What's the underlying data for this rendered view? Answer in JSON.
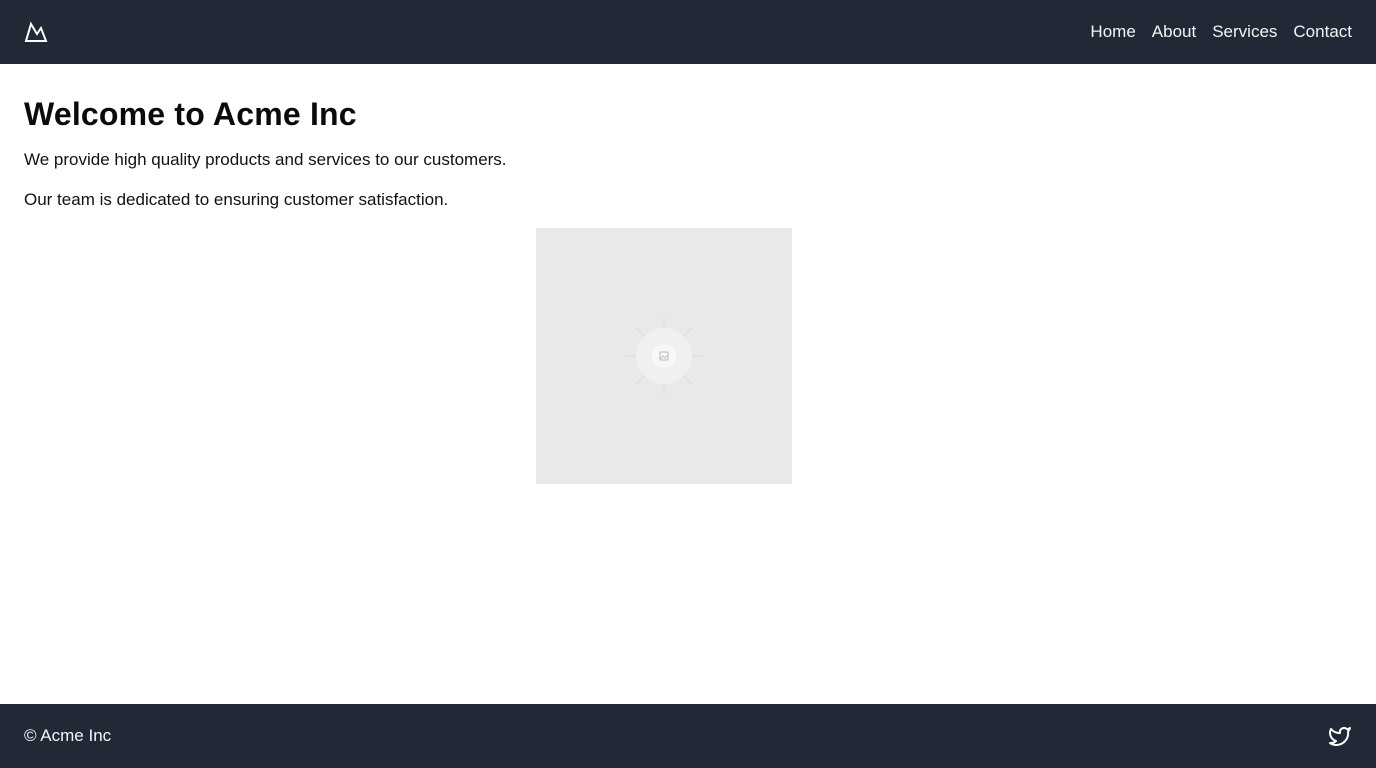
{
  "header": {
    "logo_icon": "mountain-icon",
    "nav": [
      {
        "label": "Home"
      },
      {
        "label": "About"
      },
      {
        "label": "Services"
      },
      {
        "label": "Contact"
      }
    ]
  },
  "main": {
    "title": "Welcome to Acme Inc",
    "paragraphs": [
      "We provide high quality products and services to our customers.",
      "Our team is dedicated to ensuring customer satisfaction."
    ],
    "image_icon": "image-placeholder-icon"
  },
  "footer": {
    "copyright": "© Acme Inc",
    "social_icon": "twitter-icon"
  },
  "colors": {
    "bar_background": "#212936",
    "bar_text": "#f3f4f6",
    "placeholder_background": "#e9e9e9"
  }
}
